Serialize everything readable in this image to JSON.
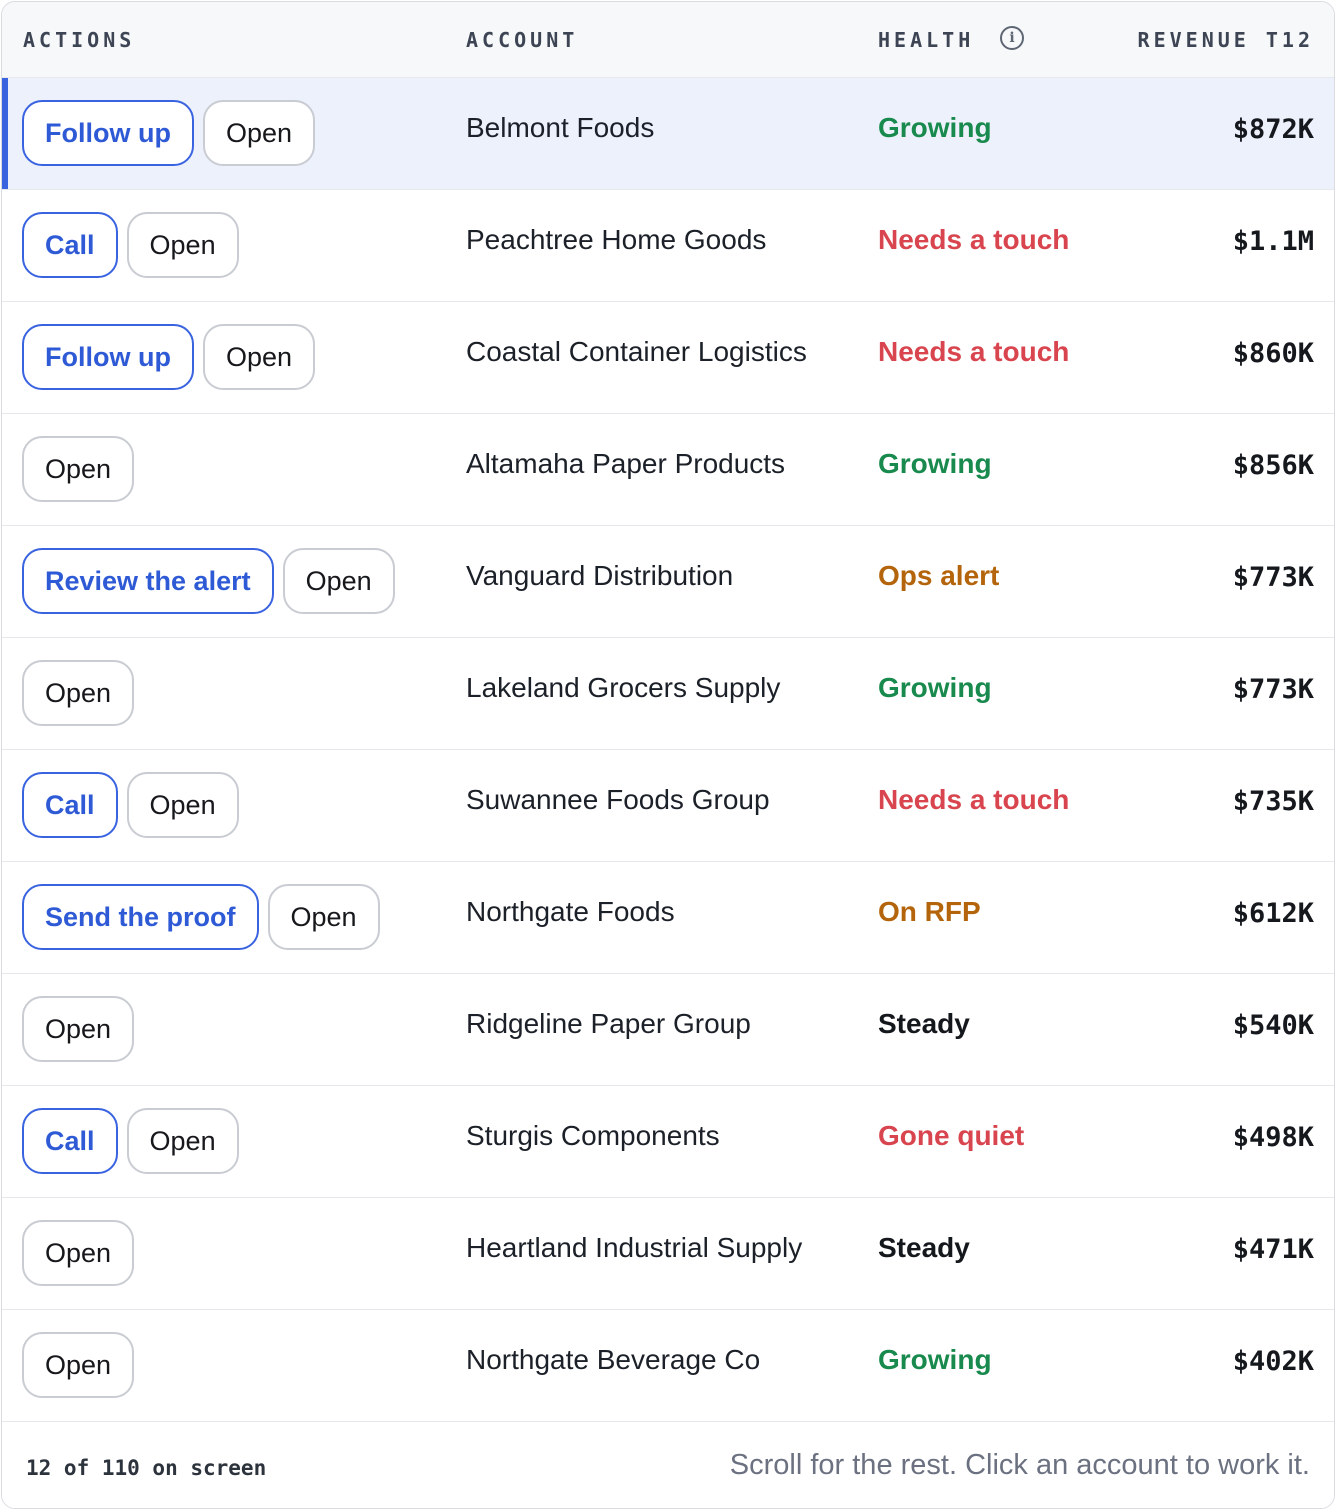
{
  "columns": {
    "actions": "ACTIONS",
    "account": "ACCOUNT",
    "health": "HEALTH",
    "revenue": "REVENUE T12"
  },
  "health_info_icon": "info-icon",
  "colors": {
    "primary": "#2f5ad6",
    "growing": "#198a4d",
    "needs_touch": "#d9454f",
    "ops": "#b4650c",
    "steady": "#14171c",
    "selected_bg": "#edf1fc"
  },
  "rows": [
    {
      "actions": [
        "Follow up",
        "Open"
      ],
      "account": "Belmont Foods",
      "health": "Growing",
      "revenue": "$872K",
      "selected": true
    },
    {
      "actions": [
        "Call",
        "Open"
      ],
      "account": "Peachtree Home Goods",
      "health": "Needs a touch",
      "revenue": "$1.1M"
    },
    {
      "actions": [
        "Follow up",
        "Open"
      ],
      "account": "Coastal Container Logistics",
      "health": "Needs a touch",
      "revenue": "$860K"
    },
    {
      "actions": [
        "Open"
      ],
      "account": "Altamaha Paper Products",
      "health": "Growing",
      "revenue": "$856K"
    },
    {
      "actions": [
        "Review the alert",
        "Open"
      ],
      "account": "Vanguard Distribution",
      "health": "Ops alert",
      "revenue": "$773K"
    },
    {
      "actions": [
        "Open"
      ],
      "account": "Lakeland Grocers Supply",
      "health": "Growing",
      "revenue": "$773K"
    },
    {
      "actions": [
        "Call",
        "Open"
      ],
      "account": "Suwannee Foods Group",
      "health": "Needs a touch",
      "revenue": "$735K"
    },
    {
      "actions": [
        "Send the proof",
        "Open"
      ],
      "account": "Northgate Foods",
      "health": "On RFP",
      "revenue": "$612K"
    },
    {
      "actions": [
        "Open"
      ],
      "account": "Ridgeline Paper Group",
      "health": "Steady",
      "revenue": "$540K"
    },
    {
      "actions": [
        "Call",
        "Open"
      ],
      "account": "Sturgis Components",
      "health": "Gone quiet",
      "revenue": "$498K"
    },
    {
      "actions": [
        "Open"
      ],
      "account": "Heartland Industrial Supply",
      "health": "Steady",
      "revenue": "$471K"
    },
    {
      "actions": [
        "Open"
      ],
      "account": "Northgate Beverage Co",
      "health": "Growing",
      "revenue": "$402K"
    }
  ],
  "footer": {
    "count": "12 of 110 on screen",
    "hint": "Scroll for the rest. Click an account to work it."
  }
}
